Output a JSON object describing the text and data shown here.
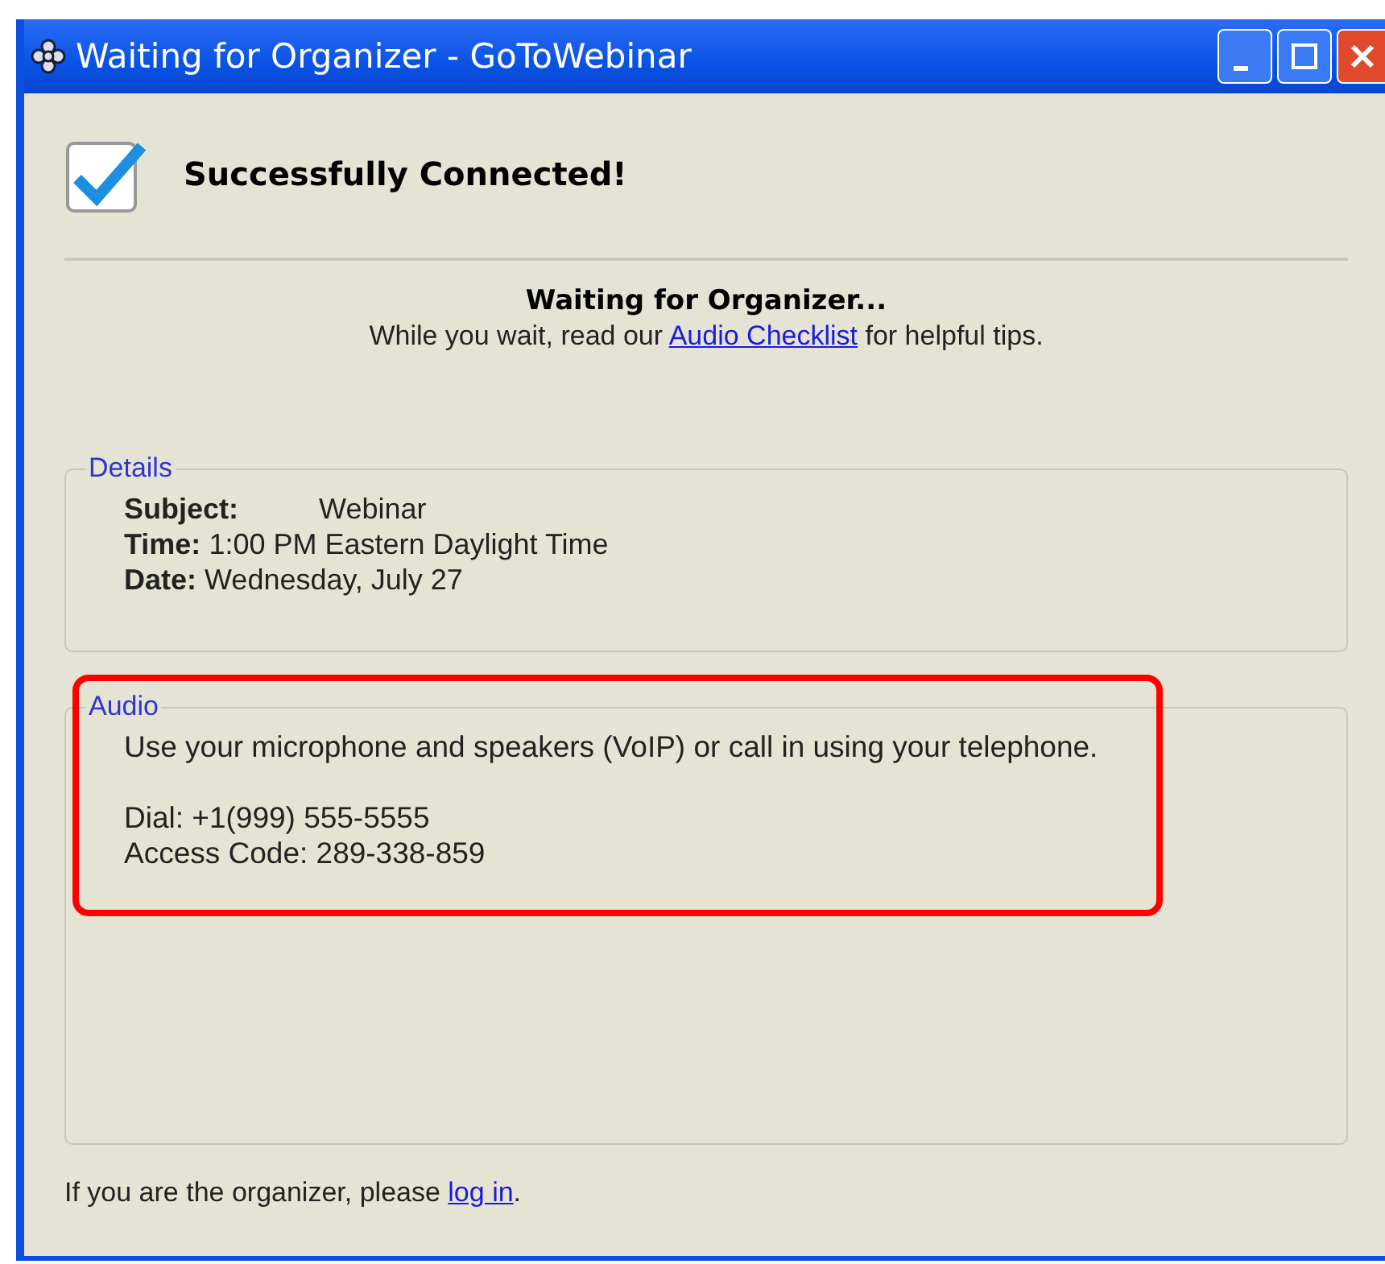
{
  "window": {
    "title": "Waiting for Organizer - GoToWebinar"
  },
  "status": {
    "checked": true,
    "text": "Successfully Connected!"
  },
  "waiting": {
    "title": "Waiting for Organizer...",
    "before": "While you wait, read our ",
    "link": "Audio Checklist",
    "after": " for helpful tips."
  },
  "details": {
    "legend": "Details",
    "lines": [
      "**Subject:**          Webinar",
      "**Time:** 1:00 PM Eastern Daylight Time",
      "**Date:** Wednesday, July 27"
    ]
  },
  "audio": {
    "legend": "Audio",
    "highlighted": true,
    "intro": "Use your microphone and speakers (VoIP) or call in using your telephone.",
    "lines": [
      "Dial: +1(999) 555-5555",
      "Access Code: 289-338-859"
    ]
  },
  "footer": {
    "before": "If you are the organizer, please ",
    "link": "log in",
    "after": "."
  }
}
